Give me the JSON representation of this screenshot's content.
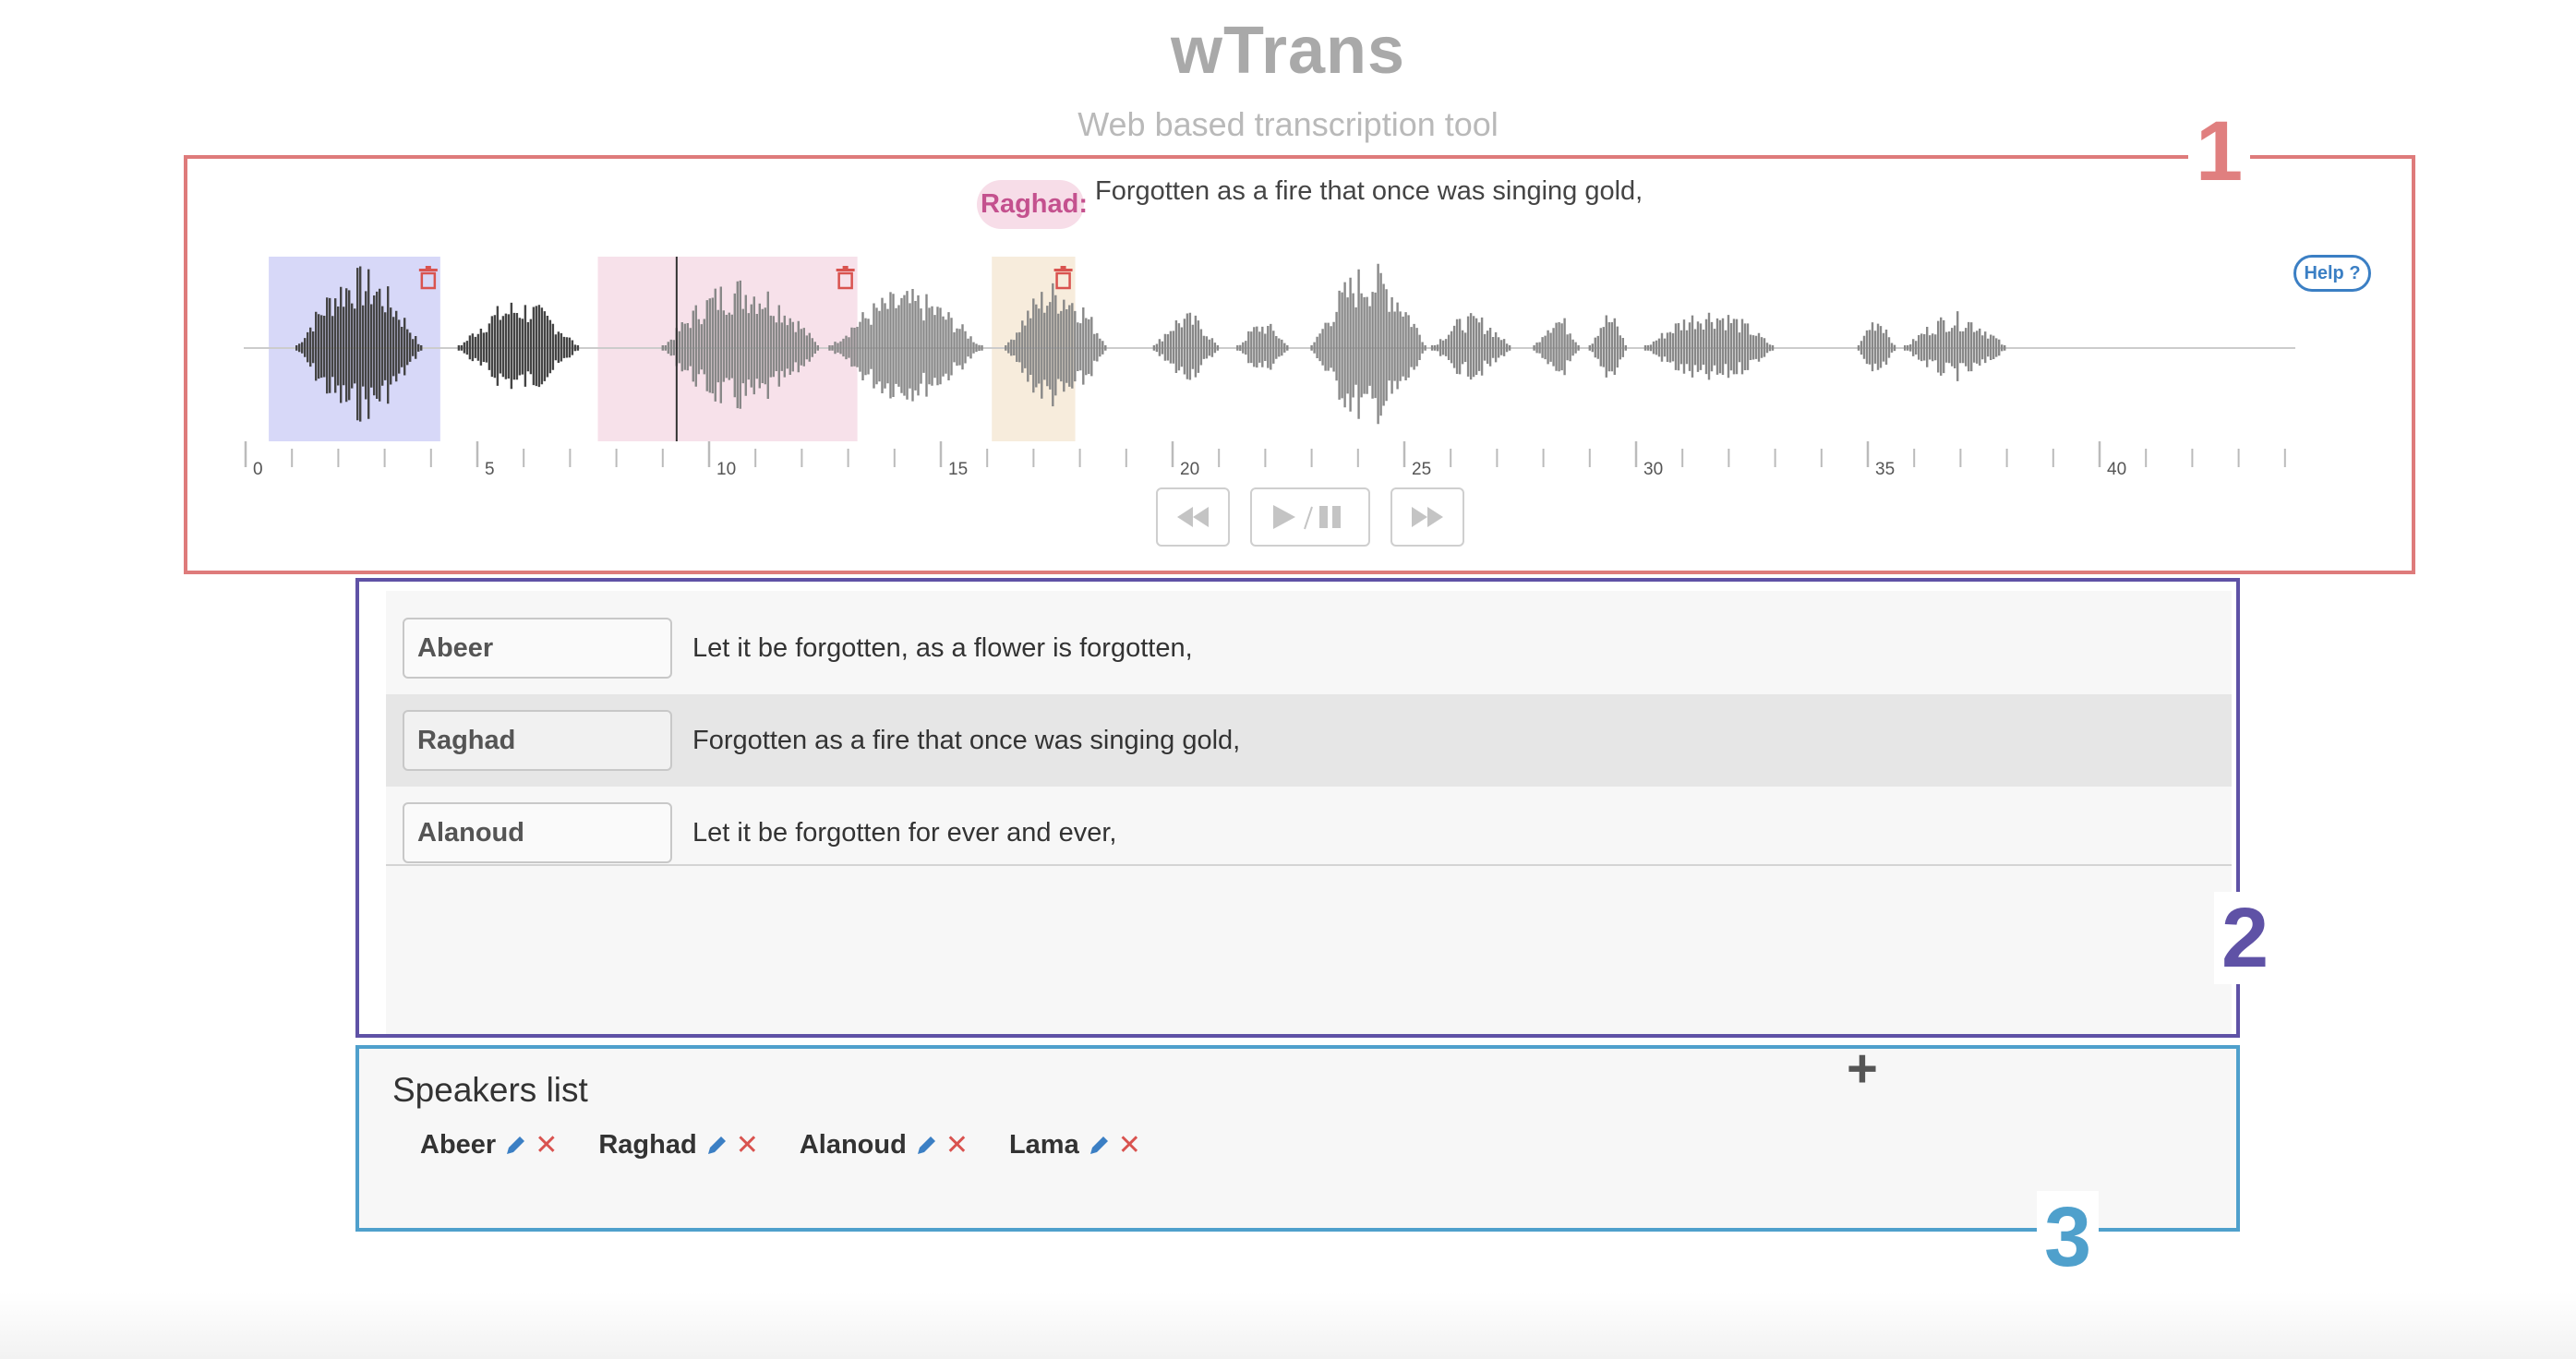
{
  "app": {
    "title": "wTrans",
    "subtitle": "Web based transcription tool"
  },
  "regions": {
    "one": "1",
    "two": "2",
    "three": "3"
  },
  "player": {
    "current_speaker": "Raghad:",
    "current_text": "Forgotten as a fire that once was singing gold,",
    "help_label": "Help ?",
    "timeline_labels": [
      "0",
      "5",
      "10",
      "15",
      "20",
      "25",
      "30",
      "35",
      "40"
    ],
    "segments": [
      {
        "speaker": "Abeer",
        "start": 0.5,
        "end": 4.2,
        "color": "#d7d8f8"
      },
      {
        "speaker": "Raghad",
        "start": 7.6,
        "end": 13.2,
        "color": "#f7e1ea"
      },
      {
        "speaker": "Alanoud",
        "start": 16.1,
        "end": 17.9,
        "color": "#f7ecdc"
      }
    ],
    "playhead": 9.3,
    "controls": {
      "rewind_icon": "rewind-icon",
      "play_pause_icon": "play-pause-icon",
      "forward_icon": "fast-forward-icon"
    }
  },
  "transcript": [
    {
      "speaker": "Abeer",
      "text": "Let it be forgotten, as a flower is forgotten,",
      "active": false
    },
    {
      "speaker": "Raghad",
      "text": "Forgotten as a fire that once was singing gold,",
      "active": true
    },
    {
      "speaker": "Alanoud",
      "text": "Let it be forgotten for ever and ever,",
      "active": false
    }
  ],
  "speakers_list": {
    "title": "Speakers list",
    "add_label": "+",
    "speakers": [
      "Abeer",
      "Raghad",
      "Alanoud",
      "Lama"
    ]
  }
}
